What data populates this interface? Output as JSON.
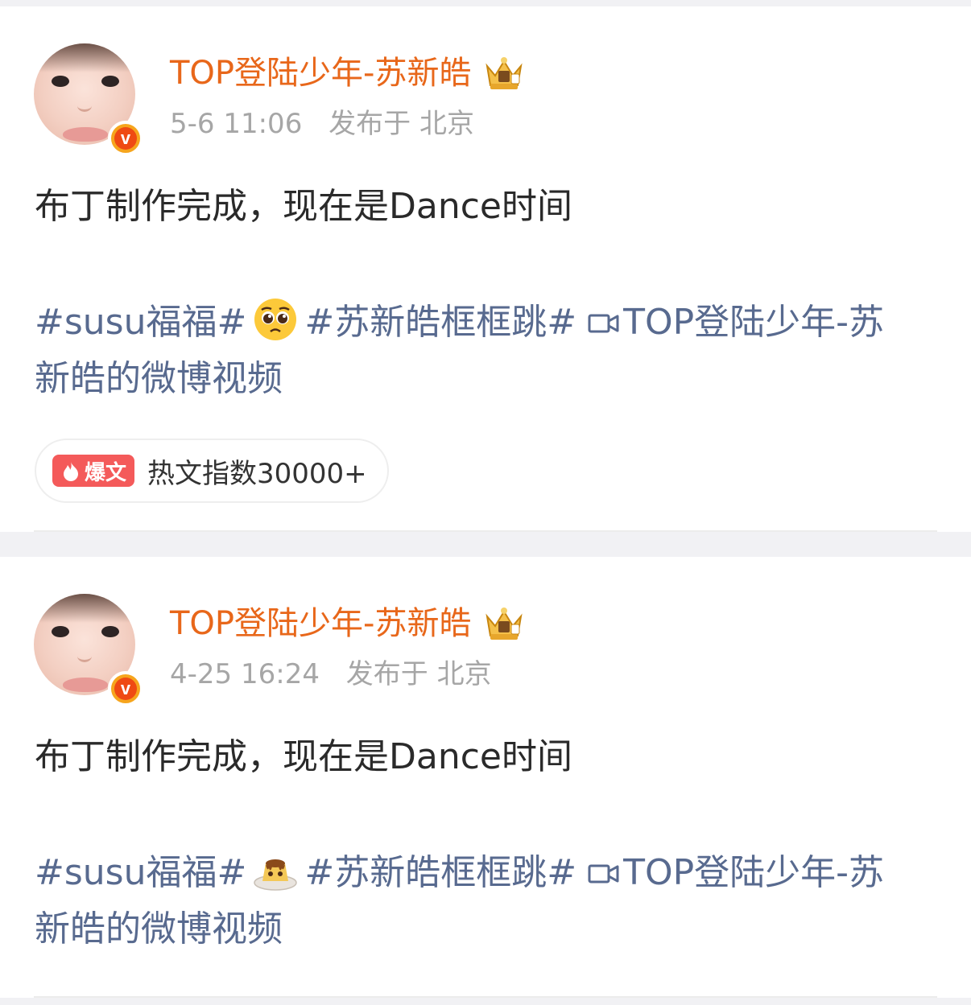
{
  "posts": [
    {
      "username": "TOP登陆少年-苏新皓",
      "time": "5-6 11:06",
      "location": "发布于 北京",
      "text": "布丁制作完成，现在是Dance时间",
      "tag1": "#susu福福#",
      "emoji": "pleading-face-emoji",
      "tag2": "#苏新皓框框跳#",
      "video_link_line1": "TOP登陆少年-苏",
      "video_link_line2": "新皓的微博视频",
      "hot_badge": "爆文",
      "hot_index": "热文指数30000+"
    },
    {
      "username": "TOP登陆少年-苏新皓",
      "time": "4-25 16:24",
      "location": "发布于 北京",
      "text": "布丁制作完成，现在是Dance时间",
      "tag1": "#susu福福#",
      "emoji": "pudding-emoji",
      "tag2": "#苏新皓框框跳#",
      "video_link_line1": "TOP登陆少年-苏",
      "video_link_line2": "新皓的微博视频"
    }
  ],
  "colors": {
    "username": "#e8671a",
    "link": "#586a8f",
    "meta": "#a6a6a6",
    "hot_badge": "#f45a5a",
    "verified_badge": "#ef4a13"
  }
}
